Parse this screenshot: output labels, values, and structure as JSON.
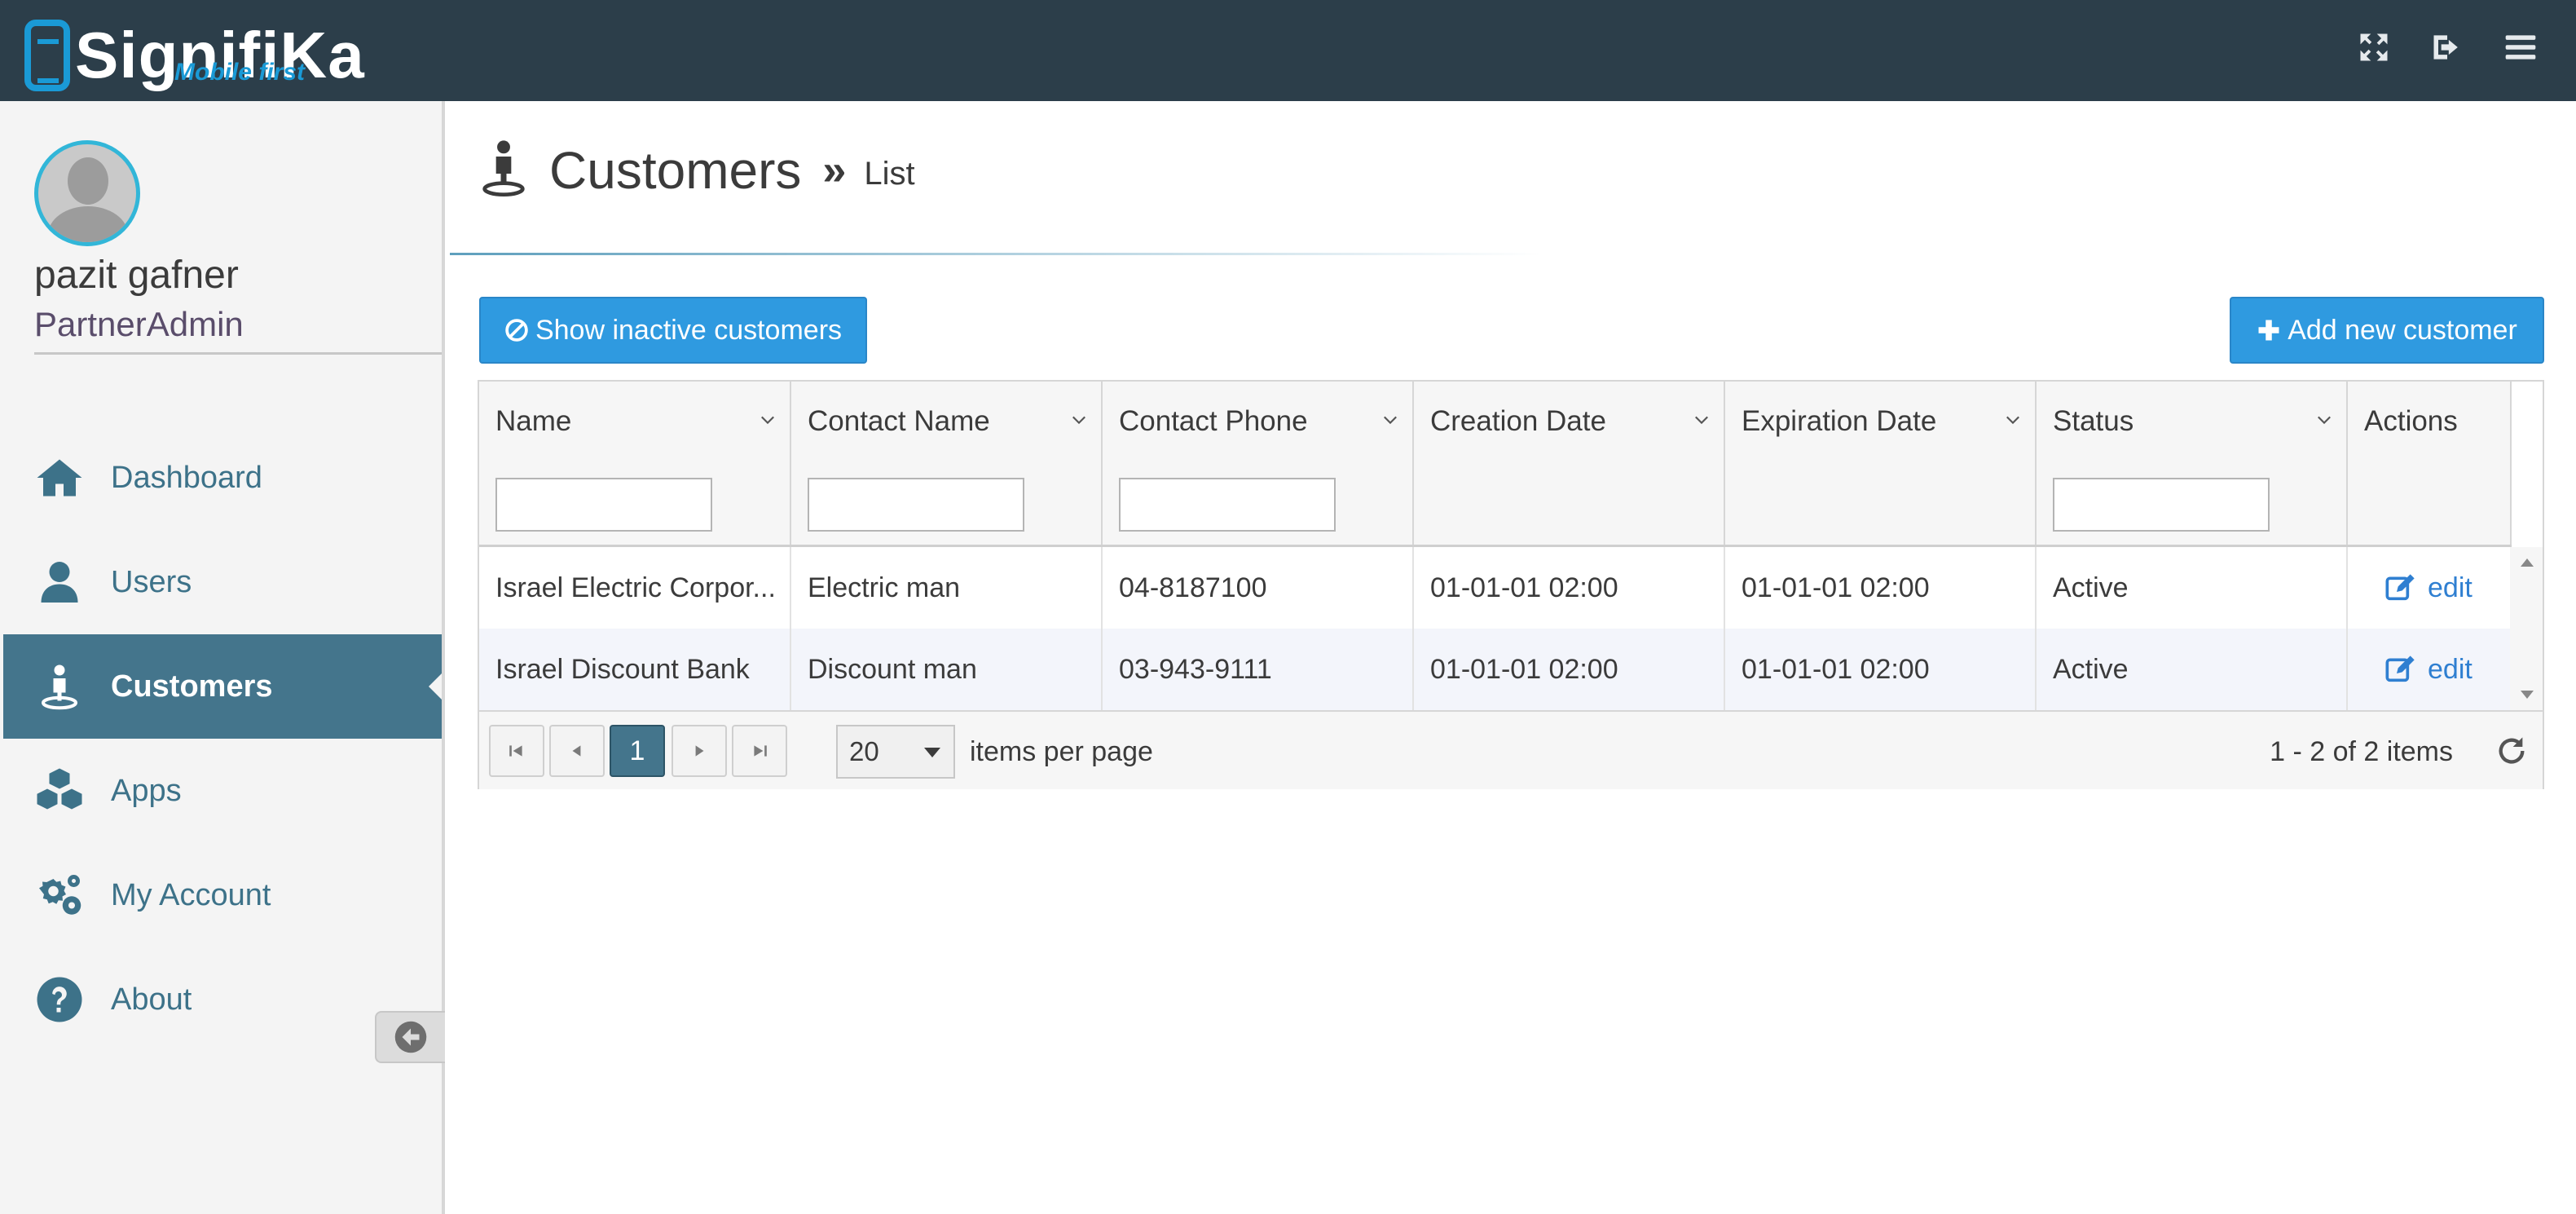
{
  "app": {
    "brand": "SignifiKa",
    "tagline": "Mobile first"
  },
  "topbar": {
    "icons": [
      "fullscreen-icon",
      "logout-icon",
      "menu-icon"
    ]
  },
  "user": {
    "name": "pazit gafner",
    "role": "PartnerAdmin"
  },
  "sidebar": {
    "items": [
      {
        "label": "Dashboard",
        "icon": "home-icon",
        "active": false
      },
      {
        "label": "Users",
        "icon": "user-icon",
        "active": false
      },
      {
        "label": "Customers",
        "icon": "customer-icon",
        "active": true
      },
      {
        "label": "Apps",
        "icon": "cubes-icon",
        "active": false
      },
      {
        "label": "My Account",
        "icon": "gears-icon",
        "active": false
      },
      {
        "label": "About",
        "icon": "question-icon",
        "active": false
      }
    ]
  },
  "page": {
    "title": "Customers",
    "separator": "»",
    "subtitle": "List"
  },
  "buttons": {
    "show_inactive": "Show inactive customers",
    "add_new": "Add new customer"
  },
  "grid": {
    "columns": [
      "Name",
      "Contact Name",
      "Contact Phone",
      "Creation Date",
      "Expiration Date",
      "Status",
      "Actions"
    ],
    "rows": [
      {
        "name": "Israel Electric Corpor...",
        "contact_name": "Electric man",
        "contact_phone": "04-8187100",
        "creation_date": "01-01-01 02:00",
        "expiration_date": "01-01-01 02:00",
        "status": "Active",
        "action": "edit"
      },
      {
        "name": "Israel Discount Bank",
        "contact_name": "Discount man",
        "contact_phone": "03-943-9111",
        "creation_date": "01-01-01 02:00",
        "expiration_date": "01-01-01 02:00",
        "status": "Active",
        "action": "edit"
      }
    ]
  },
  "pager": {
    "current_page": "1",
    "page_size": "20",
    "items_per_page_label": "items per page",
    "info": "1 - 2 of 2 items"
  },
  "colors": {
    "topbar": "#2c3e4a",
    "accent": "#2f9ae0",
    "sidebar_active": "#44758c",
    "link": "#2f7fd1"
  }
}
